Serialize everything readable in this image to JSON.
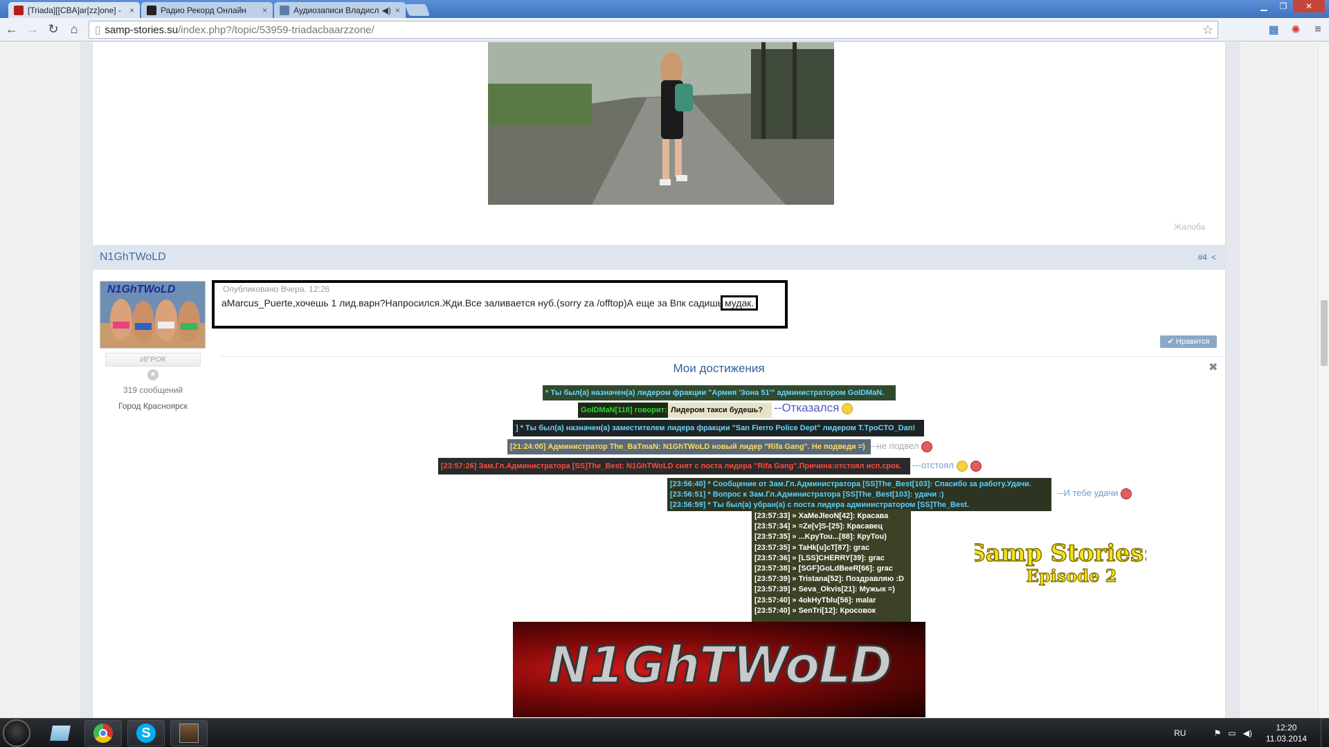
{
  "browser": {
    "tabs": [
      {
        "label": "[Triada][[CBA]ar[zz]one] -",
        "close": "×"
      },
      {
        "label": "Радио Рекорд Онлайн",
        "close": "×"
      },
      {
        "label": "Аудиозаписи Владисл",
        "close": "×"
      }
    ],
    "url_host": "samp-stories.su",
    "url_path": "/index.php?/topic/53959-triadacbaarzzone/"
  },
  "page": {
    "complaint": "Жалоба",
    "post": {
      "author": "N1GhTWoLD",
      "number": "#4",
      "rank": "ИГРОК",
      "post_count": "319 сообщений",
      "city": "Город Красноярск",
      "published": "Опубликовано Вчера, 12:26",
      "message": "aMarcus_Puerte,хочешь 1 лид.варн?Напросился.Жди.Все заливается нуб.(sorry za /offtop)А еще за Впк садишь",
      "message_highlight": "мудак.",
      "like_label": "Нравится"
    },
    "signature": {
      "title": "Мои достижения",
      "lines": {
        "l1": "* Ты был(а) назначен(а) лидером фракции \"Армия 'Зона 51'\" администратором GoIDMaN.",
        "l2a": "GoIDMaN[118] говорит:",
        "l2b": "Лидером такси будешь?",
        "c1": "--Отказался",
        "l3": "] * Ты был(а) назначен(а) заместителем лидера фракции \"San Fierro Police Dept\" лидером T.TpoCTO_Dan!",
        "l4": "[21:24:00] Администратор The_BaTmaN: N1GhTWoLD новый лидер \"Rifa Gang\". Не подведи =)",
        "c2": "--не подвел",
        "l5": "[23:57:26] Зам.Гл.Администратора [SS]The_Best: N1GhTWoLD снят с поста лидера \"Rifa Gang\".Причина:отстоял исп.срок.",
        "c3": "---отстоял",
        "l6a": "[23:56:40] * Сообщение от Зам.Гл.Администратора [SS]The_Best[103]: Спасибо за работу.Удачи.",
        "l6b": "[23:56:51] * Вопрос к Зам.Гл.Администратора [SS]The_Best[103]: удачи :)",
        "l6c": "[23:56:59] * Ты был(а) убран(а) с поста лидера администратором [SS]The_Best.",
        "c4": "--И тебе удачи"
      },
      "chat": [
        "[23:57:33] » XaMeJIeoN[42]: Красава",
        "[23:57:34] » =Ze[v]S-[25]: Красавец",
        "[23:57:35] » ...KpyTou...[88]: КруТоu)",
        "[23:57:35] » TaHk[u]cT[87]: grac",
        "[23:57:36] » [LSS]CHERRY[39]: grac",
        "[23:57:38] » [SGF]GoLdBeeR[66]: grac",
        "[23:57:39] » Tristana[52]: Поздравляю :D",
        "[23:57:39] » Seva_Okvis[21]: Мужык =)",
        "[23:57:40] » 4okHyTblu[56]: malar",
        "[23:57:40] » SenTri[12]: Кросовок"
      ],
      "logo_line1": "Samp Stories:",
      "logo_line2": "Episode 2",
      "banner": "N1GhTWoLD"
    }
  },
  "taskbar": {
    "lang": "RU",
    "time": "12:20",
    "date": "11.03.2014"
  },
  "colors": {
    "link": "#3a6fa8",
    "postbar": "#dfe5ee",
    "chat_green_bg": "#3b4226"
  }
}
